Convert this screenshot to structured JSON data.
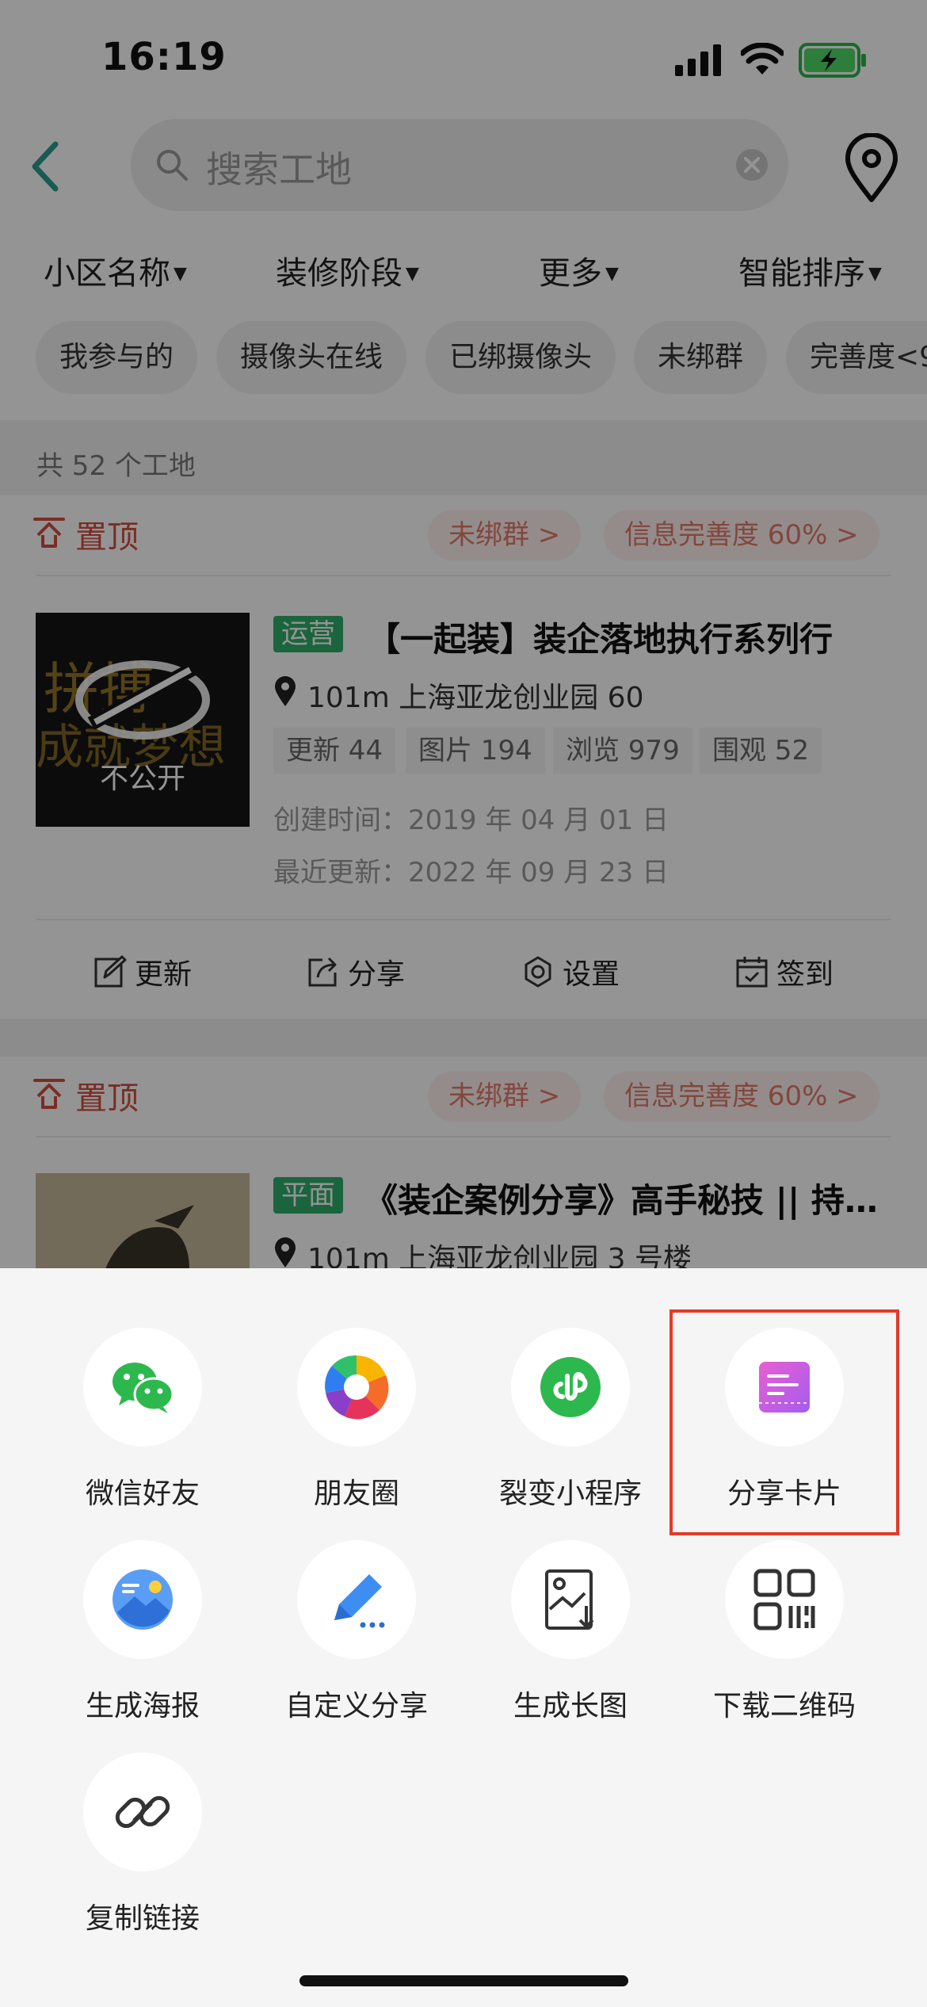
{
  "status_bar": {
    "time": "16:19"
  },
  "header": {
    "search_placeholder": "搜索工地"
  },
  "filters": {
    "dropdowns": [
      "小区名称",
      "装修阶段",
      "更多",
      "智能排序"
    ],
    "chips": [
      "我参与的",
      "摄像头在线",
      "已绑摄像头",
      "未绑群",
      "完善度<9"
    ]
  },
  "list": {
    "count_text": "共 52 个工地",
    "cards": [
      {
        "pin_label": "置顶",
        "unbound_tag": "未绑群 >",
        "completeness_tag": "信息完善度 60% >",
        "badge": "运营",
        "title": "【一起装】装企落地执行系列行",
        "location": "101m  上海亚龙创业园  60",
        "stats": [
          "更新 44",
          "图片 194",
          "浏览 979",
          "围观 52"
        ],
        "created": "创建时间：2019 年 04 月 01 日",
        "updated": "最近更新：2022 年 09 月 23 日",
        "thumb_text": "不公开",
        "actions": [
          "更新",
          "分享",
          "设置",
          "签到"
        ]
      },
      {
        "pin_label": "置顶",
        "unbound_tag": "未绑群 >",
        "completeness_tag": "信息完善度 60% >",
        "badge": "平面",
        "title": "《装企案例分享》高手秘技 || 持…",
        "location": "101m  上海亚龙创业园  3 号楼"
      }
    ]
  },
  "share_sheet": {
    "items": [
      {
        "label": "微信好友",
        "icon": "wechat-icon"
      },
      {
        "label": "朋友圈",
        "icon": "moments-icon"
      },
      {
        "label": "裂变小程序",
        "icon": "mini-program-icon"
      },
      {
        "label": "分享卡片",
        "icon": "card-icon"
      },
      {
        "label": "生成海报",
        "icon": "poster-icon"
      },
      {
        "label": "自定义分享",
        "icon": "pen-icon"
      },
      {
        "label": "生成长图",
        "icon": "long-image-icon"
      },
      {
        "label": "下载二维码",
        "icon": "qr-code-icon"
      },
      {
        "label": "复制链接",
        "icon": "link-icon"
      }
    ]
  },
  "colors": {
    "accent": "#2a9d8f",
    "warning": "#d24f3f",
    "highlight": "#e33a2a",
    "badge_green": "#2fae6c"
  }
}
